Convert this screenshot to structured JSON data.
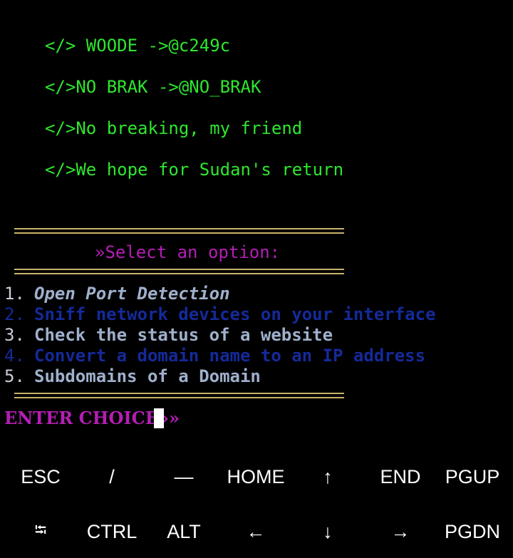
{
  "banner": [
    "</> WOODE ->@c249c",
    "</>NO BRAK ->@NO_BRAK",
    "</>No breaking, my friend",
    "</>We hope for Sudan's return"
  ],
  "menu": {
    "title": "»Select an option:",
    "options": [
      {
        "num": "1.",
        "label": "Open Port Detection"
      },
      {
        "num": "2.",
        "label": "Sniff network devices on your interface"
      },
      {
        "num": "3.",
        "label": "Check the status of a website"
      },
      {
        "num": "4.",
        "label": "Convert a domain name to an IP address"
      },
      {
        "num": "5.",
        "label": "Subdomains of a Domain"
      }
    ]
  },
  "prompt": "ENTER CHOICE»» ",
  "extra_keys": {
    "row1": [
      "ESC",
      "/",
      "—",
      "HOME",
      "↑",
      "END",
      "PGUP"
    ],
    "row2": [
      "⭾",
      "CTRL",
      "ALT",
      "←",
      "↓",
      "→",
      "PGDN"
    ]
  },
  "colors": {
    "banner": "#2ee62e",
    "accent": "#b41eb4",
    "rule": "#c8b26a",
    "option_light": "#9fb0cc",
    "option_dark": "#142a9a"
  }
}
